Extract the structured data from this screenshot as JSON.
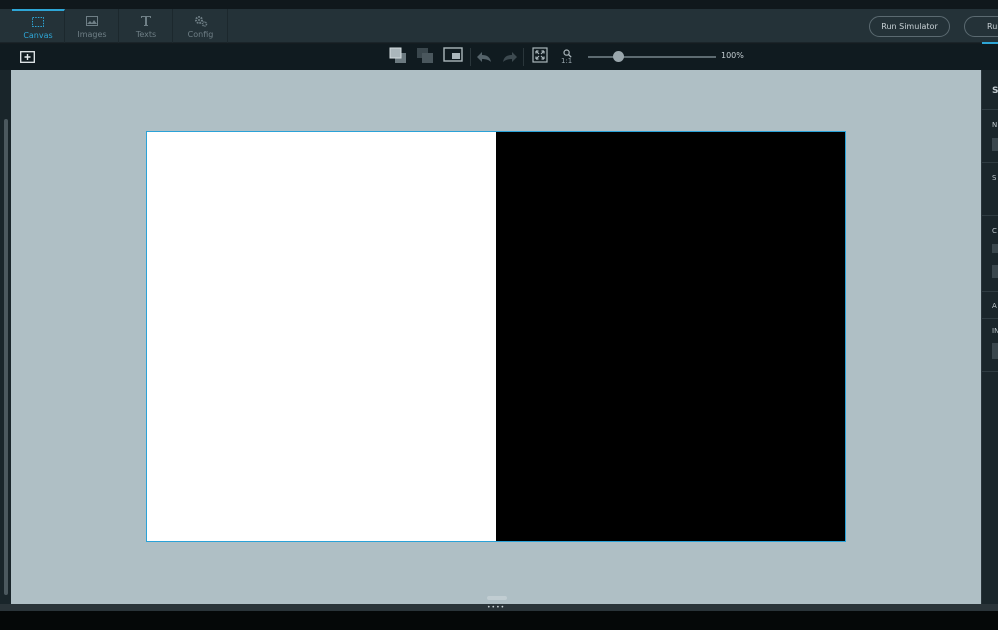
{
  "tabs": [
    {
      "label": "Canvas",
      "icon": "canvas-select-icon",
      "active": true
    },
    {
      "label": "Images",
      "icon": "image-icon",
      "active": false
    },
    {
      "label": "Texts",
      "icon": "text-icon",
      "active": false
    },
    {
      "label": "Config",
      "icon": "gear-icon",
      "active": false
    }
  ],
  "header": {
    "run_simulator_label": "Run Simulator",
    "run_label": "Run"
  },
  "toolbar": {
    "one_to_one_label": "1:1",
    "zoom_label": "100%",
    "zoom_level": 0.2
  },
  "right_panel": {
    "labels": [
      "S",
      "N",
      "S",
      "C",
      "A",
      "IN"
    ]
  },
  "canvas": {
    "left_color": "#ffffff",
    "right_color": "#000000",
    "border_color": "#2aa2d8"
  },
  "colors": {
    "accent": "#2ea6d6",
    "workspace": "#afbfc5"
  }
}
